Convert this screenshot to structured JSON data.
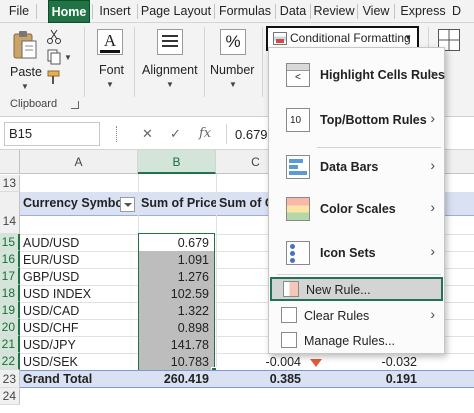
{
  "menu": {
    "tabs": [
      "File",
      "Home",
      "Insert",
      "Page Layout",
      "Formulas",
      "Data",
      "Review",
      "View",
      "Express",
      "D"
    ],
    "active": "Home"
  },
  "ribbon": {
    "paste_label": "Paste",
    "font_label": "Font",
    "alignment_label": "Alignment",
    "number_label": "Number",
    "clipboard_label": "Clipboard",
    "conditional_formatting_label": "Conditional Formatting",
    "number_icon_glyph": "%",
    "font_icon_glyph": "A"
  },
  "formula_bar": {
    "name_box": "B15",
    "cancel_glyph": "✕",
    "enter_glyph": "✓",
    "fx_glyph": "fx",
    "value": "0.679"
  },
  "grid": {
    "columns": [
      "A",
      "B",
      "C"
    ],
    "header_row": {
      "row_number": "14",
      "a": "Currency Symbol",
      "b": "Sum of Price",
      "c": "Sum of C"
    },
    "blank_row_number": "13",
    "rows": [
      {
        "row": "15",
        "a": "AUD/USD",
        "b": "0.679"
      },
      {
        "row": "16",
        "a": "EUR/USD",
        "b": "1.091"
      },
      {
        "row": "17",
        "a": "GBP/USD",
        "b": "1.276"
      },
      {
        "row": "18",
        "a": "USD INDEX",
        "b": "102.59"
      },
      {
        "row": "19",
        "a": "USD/CAD",
        "b": "1.322"
      },
      {
        "row": "20",
        "a": "USD/CHF",
        "b": "0.898"
      },
      {
        "row": "21",
        "a": "USD/JPY",
        "b": "141.78"
      },
      {
        "row": "22",
        "a": "USD/SEK",
        "b": "10.783",
        "c": "-0.004",
        "e": "-0.032"
      }
    ],
    "total_row": {
      "row": "23",
      "a": "Grand Total",
      "b": "260.419",
      "c": "0.385",
      "e": "0.191"
    },
    "last_row_number": "24",
    "colors": {
      "accent": "#217346",
      "header_fill": "#d9e1f2",
      "selection_fill": "#bdbdbd",
      "negative_arrow": "#e05c3d"
    }
  },
  "dropdown": {
    "items": [
      {
        "label": "Highlight Cells Rules",
        "underline": "H",
        "has_submenu": true,
        "icon": "highlight-cells-icon"
      },
      {
        "label": "Top/Bottom Rules",
        "underline": "T",
        "has_submenu": true,
        "icon": "top-bottom-icon"
      },
      {
        "label": "Data Bars",
        "underline": "D",
        "has_submenu": true,
        "icon": "data-bars-icon"
      },
      {
        "label": "Color Scales",
        "underline": "S",
        "has_submenu": true,
        "icon": "color-scales-icon"
      },
      {
        "label": "Icon Sets",
        "underline": "I",
        "has_submenu": true,
        "icon": "icon-sets-icon"
      }
    ],
    "new_rule": "New Rule...",
    "clear_rules": "Clear Rules",
    "manage_rules": "Manage Rules...",
    "top_bottom_icon_text": "10",
    "highlight_icon_text": "<"
  }
}
